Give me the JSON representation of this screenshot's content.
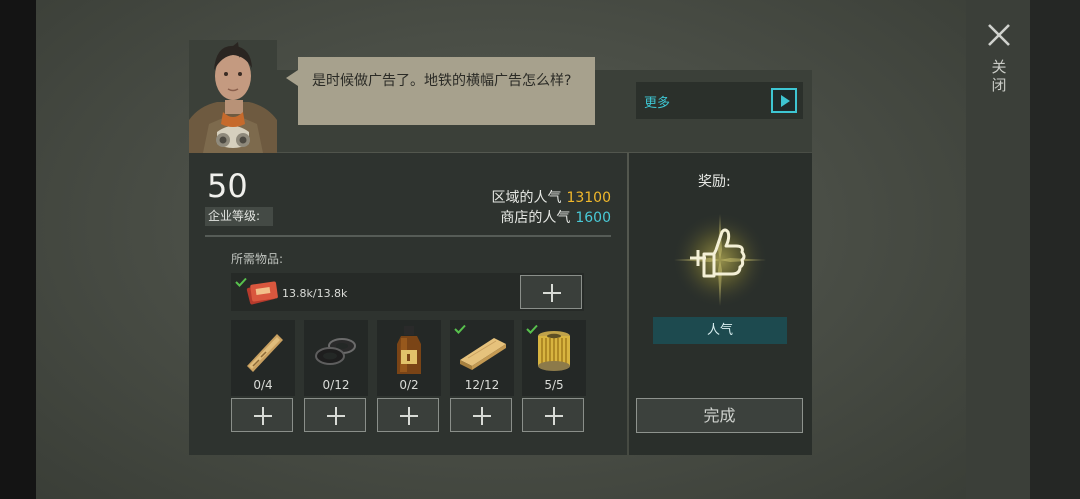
{
  "close": {
    "label": "关闭"
  },
  "dialog": {
    "speech": "是时候做广告了。地铁的横幅广告怎么样?",
    "more_label": "更多"
  },
  "company": {
    "level": "50",
    "level_label": "企业等级:",
    "region_popularity_label": "区域的人气",
    "region_popularity_value": "13100",
    "shop_popularity_label": "商店的人气",
    "shop_popularity_value": "1600"
  },
  "requirements": {
    "label": "所需物品:",
    "ticket": {
      "amount": "13.8k/13.8k",
      "complete": true
    },
    "items": [
      {
        "icon": "wooden-stick-icon",
        "count": "0/4",
        "complete": false
      },
      {
        "icon": "rubber-gasket-icon",
        "count": "0/12",
        "complete": false
      },
      {
        "icon": "oil-bottle-icon",
        "count": "0/2",
        "complete": false
      },
      {
        "icon": "wooden-plank-icon",
        "count": "12/12",
        "complete": true
      },
      {
        "icon": "oil-filter-icon",
        "count": "5/5",
        "complete": true
      }
    ]
  },
  "reward": {
    "title": "奖励:",
    "icon": "plus-thumbs-up-icon",
    "name": "人气"
  },
  "finish_label": "完成",
  "colors": {
    "accent_cyan": "#3ec6d3",
    "accent_yellow": "#f1b82b",
    "check_green": "#58c14d",
    "reward_glow": "#e8d64a"
  }
}
